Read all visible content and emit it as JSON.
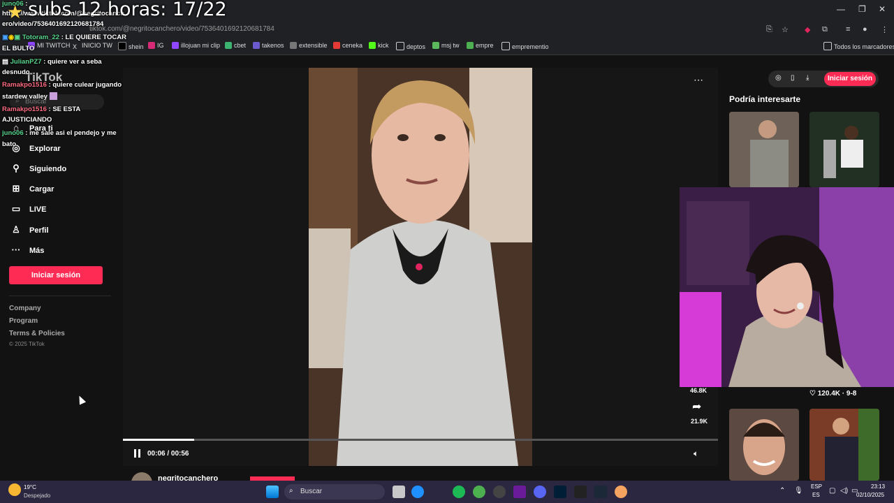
{
  "stream": {
    "title": "subs 12 horas: 17/22"
  },
  "browser": {
    "url": "tiktok.com/@negritocanchero/video/7536401692120681784",
    "bookmarks": [
      "MI TWITCH",
      "INICIO TW",
      "shein",
      "IG",
      "illojuan mi clip",
      "cbet",
      "takenos",
      "extensible",
      "ceneka",
      "kick",
      "deptos",
      "msj tw",
      "empre",
      "emprementio"
    ],
    "all_bookmarks": "Todos los marcadores"
  },
  "chat": [
    {
      "user": "juno06",
      "text": ":"
    },
    {
      "user": "",
      "text": "https://www.tiktok.com/@negritocanch"
    },
    {
      "user": "",
      "text": "ero/video/7536401692120681784"
    },
    {
      "user": "Totoram_22",
      "text": ": LE QUIERE TOCAR"
    },
    {
      "user": "",
      "text": "EL BULTO"
    },
    {
      "user": "JulianPZ7",
      "text": ": quiere ver a seba"
    },
    {
      "user": "",
      "text": "desnudo"
    },
    {
      "user": "Ramakpo1516",
      "text": ": quiere culear jugando"
    },
    {
      "user": "",
      "text": "stardew valley"
    },
    {
      "user": "Ramakpo1516",
      "text": ": SE ESTA"
    },
    {
      "user": "",
      "text": "AJUSTICIANDO"
    },
    {
      "user": "juno06",
      "text": ": me sale asi el pendejo y me"
    },
    {
      "user": "",
      "text": "bato"
    }
  ],
  "sidebar": {
    "logo": "TikTok",
    "search_placeholder": "Buscar",
    "items": [
      "Para ti",
      "Explorar",
      "Siguiendo",
      "Cargar",
      "LIVE",
      "Perfil",
      "Más"
    ],
    "login": "Iniciar sesión",
    "footer": [
      "Company",
      "Program",
      "Terms & Policies"
    ],
    "copyright": "© 2025 TikTok"
  },
  "player": {
    "time": "00:06 / 00:56",
    "progress_fraction": 0.12,
    "shares": "21.9K",
    "saves": "46.8K",
    "author": "negritocanchero"
  },
  "right": {
    "login": "Iniciar sesión",
    "heading": "Podría interesarte",
    "likes": "120.4K",
    "date": "9-8"
  },
  "taskbar": {
    "temp": "19°C",
    "weather": "Despejado",
    "search": "Buscar",
    "lang1": "ESP",
    "lang2": "ES",
    "clock": "23:13",
    "date": "02/10/2025"
  }
}
